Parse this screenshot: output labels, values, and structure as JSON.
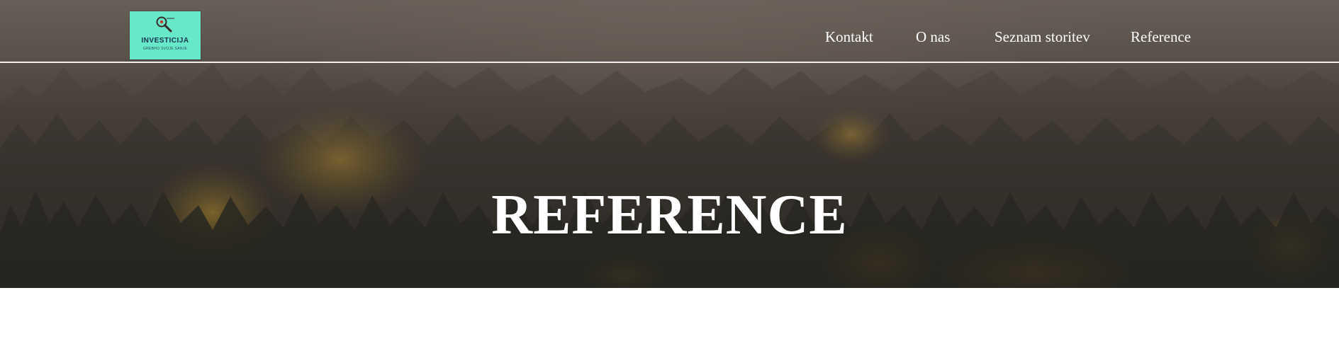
{
  "header": {
    "logo": {
      "name": "INVESTICIJA",
      "tagline": "GREBHO SVOJE SANJE",
      "background_color": "#67e8c9",
      "icon": "magnifier-icon"
    },
    "nav": [
      {
        "label": "Kontakt"
      },
      {
        "label": "O nas"
      },
      {
        "label": "Seznam storitev"
      },
      {
        "label": "Reference"
      }
    ]
  },
  "hero": {
    "title": "REFERENCE",
    "background": "misty-forest-photo"
  },
  "colors": {
    "nav_text": "#ffffff",
    "divider": "#ffffff",
    "page_background": "#ffffff"
  }
}
